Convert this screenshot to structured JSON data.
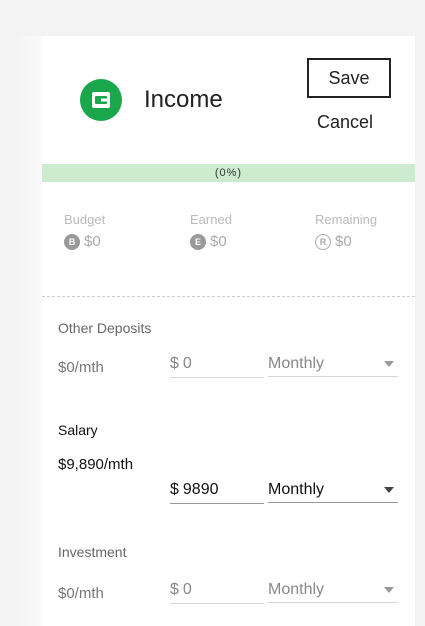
{
  "header": {
    "title": "Income",
    "save_label": "Save",
    "cancel_label": "Cancel",
    "accent_color": "#1aa64a"
  },
  "progress": {
    "label": "(0%)",
    "percent": 0,
    "color": "#cdeccf"
  },
  "summary": {
    "budget": {
      "label": "Budget",
      "badge": "B",
      "value": "$0"
    },
    "earned": {
      "label": "Earned",
      "badge": "E",
      "value": "$0"
    },
    "remaining": {
      "label": "Remaining",
      "badge": "R",
      "value": "$0"
    }
  },
  "rows": [
    {
      "label": "Other Deposits",
      "rate": "$0/mth",
      "currency": "$",
      "amount": "0",
      "frequency": "Monthly"
    },
    {
      "label": "Salary",
      "rate": "$9,890/mth",
      "currency": "$",
      "amount": "9890",
      "frequency": "Monthly"
    },
    {
      "label": "Investment",
      "rate": "$0/mth",
      "currency": "$",
      "amount": "0",
      "frequency": "Monthly"
    }
  ]
}
